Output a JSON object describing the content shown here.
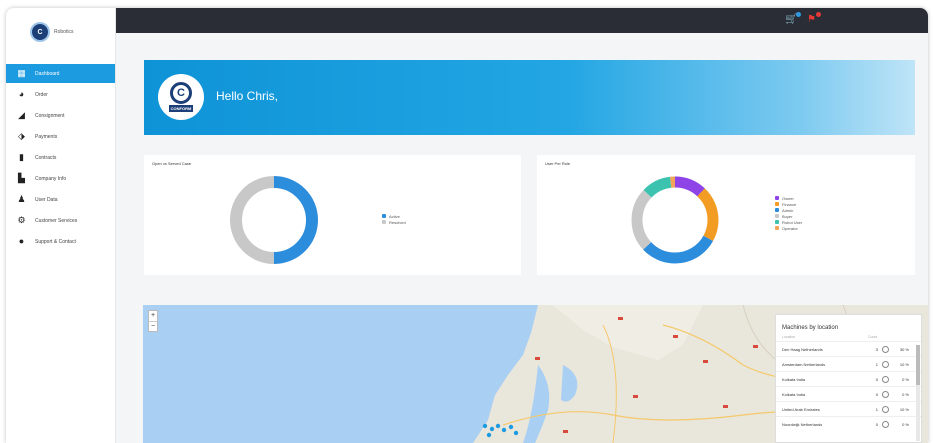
{
  "brand": {
    "text": "Robotics"
  },
  "sidebar": {
    "items": [
      {
        "label": "Dashboard",
        "icon": "dashboard-icon",
        "glyph": "▦",
        "active": true
      },
      {
        "label": "Order",
        "icon": "globe-icon",
        "glyph": "◕",
        "active": false
      },
      {
        "label": "Consignment",
        "icon": "chart-icon",
        "glyph": "◢",
        "active": false
      },
      {
        "label": "Payments",
        "icon": "payments-icon",
        "glyph": "⬗",
        "active": false
      },
      {
        "label": "Contracts",
        "icon": "document-icon",
        "glyph": "▮",
        "active": false
      },
      {
        "label": "Company Info",
        "icon": "company-icon",
        "glyph": "▙",
        "active": false
      },
      {
        "label": "User Data",
        "icon": "user-icon",
        "glyph": "♟",
        "active": false
      },
      {
        "label": "Customer Services",
        "icon": "service-icon",
        "glyph": "⚙",
        "active": false
      },
      {
        "label": "Support & Contact",
        "icon": "info-icon",
        "glyph": "●",
        "active": false
      }
    ]
  },
  "topbar": {
    "icons": [
      {
        "name": "cart-icon",
        "glyph": "🛒",
        "badge_color": "#2d9be3"
      },
      {
        "name": "alert-icon",
        "glyph": "⚑",
        "badge_color": "#e53935"
      }
    ]
  },
  "hero": {
    "greeting": "Hello Chris,",
    "logo_caption": "CONFORM"
  },
  "cards": [
    {
      "title": "Open vs Served Case",
      "chart_data": {
        "type": "pie",
        "labels": [
          "Active",
          "Resolved"
        ],
        "values": [
          50,
          50
        ],
        "colors": [
          "#2d8ddd",
          "#c8c8c8"
        ],
        "legend": "right"
      }
    },
    {
      "title": "User Per Role",
      "chart_data": {
        "type": "pie",
        "labels": [
          "Owner",
          "Finance",
          "Admin",
          "Buyer",
          "Robot User",
          "Operator"
        ],
        "values": [
          12,
          21,
          30,
          24,
          11,
          2
        ],
        "colors": [
          "#8e44e6",
          "#f39c23",
          "#2d8ddd",
          "#c8c8c8",
          "#3cc3b0",
          "#f0a55a"
        ],
        "legend": "right"
      }
    }
  ],
  "map": {
    "zoom_in": "+",
    "zoom_out": "−"
  },
  "machines": {
    "title": "Machines by location",
    "columns": [
      "Location",
      "Count"
    ],
    "rows": [
      {
        "name": "Den Haag Netherlands",
        "count": "3",
        "pct": "30 %"
      },
      {
        "name": "Amsterdam Netherlands",
        "count": "1",
        "pct": "10 %"
      },
      {
        "name": "Kolkata India",
        "count": "0",
        "pct": "0 %"
      },
      {
        "name": "Kolkata India",
        "count": "0",
        "pct": "0 %"
      },
      {
        "name": "United Arab Emirates",
        "count": "1",
        "pct": "10 %"
      },
      {
        "name": "Noordwijk Netherlands",
        "count": "0",
        "pct": "0 %"
      }
    ]
  }
}
